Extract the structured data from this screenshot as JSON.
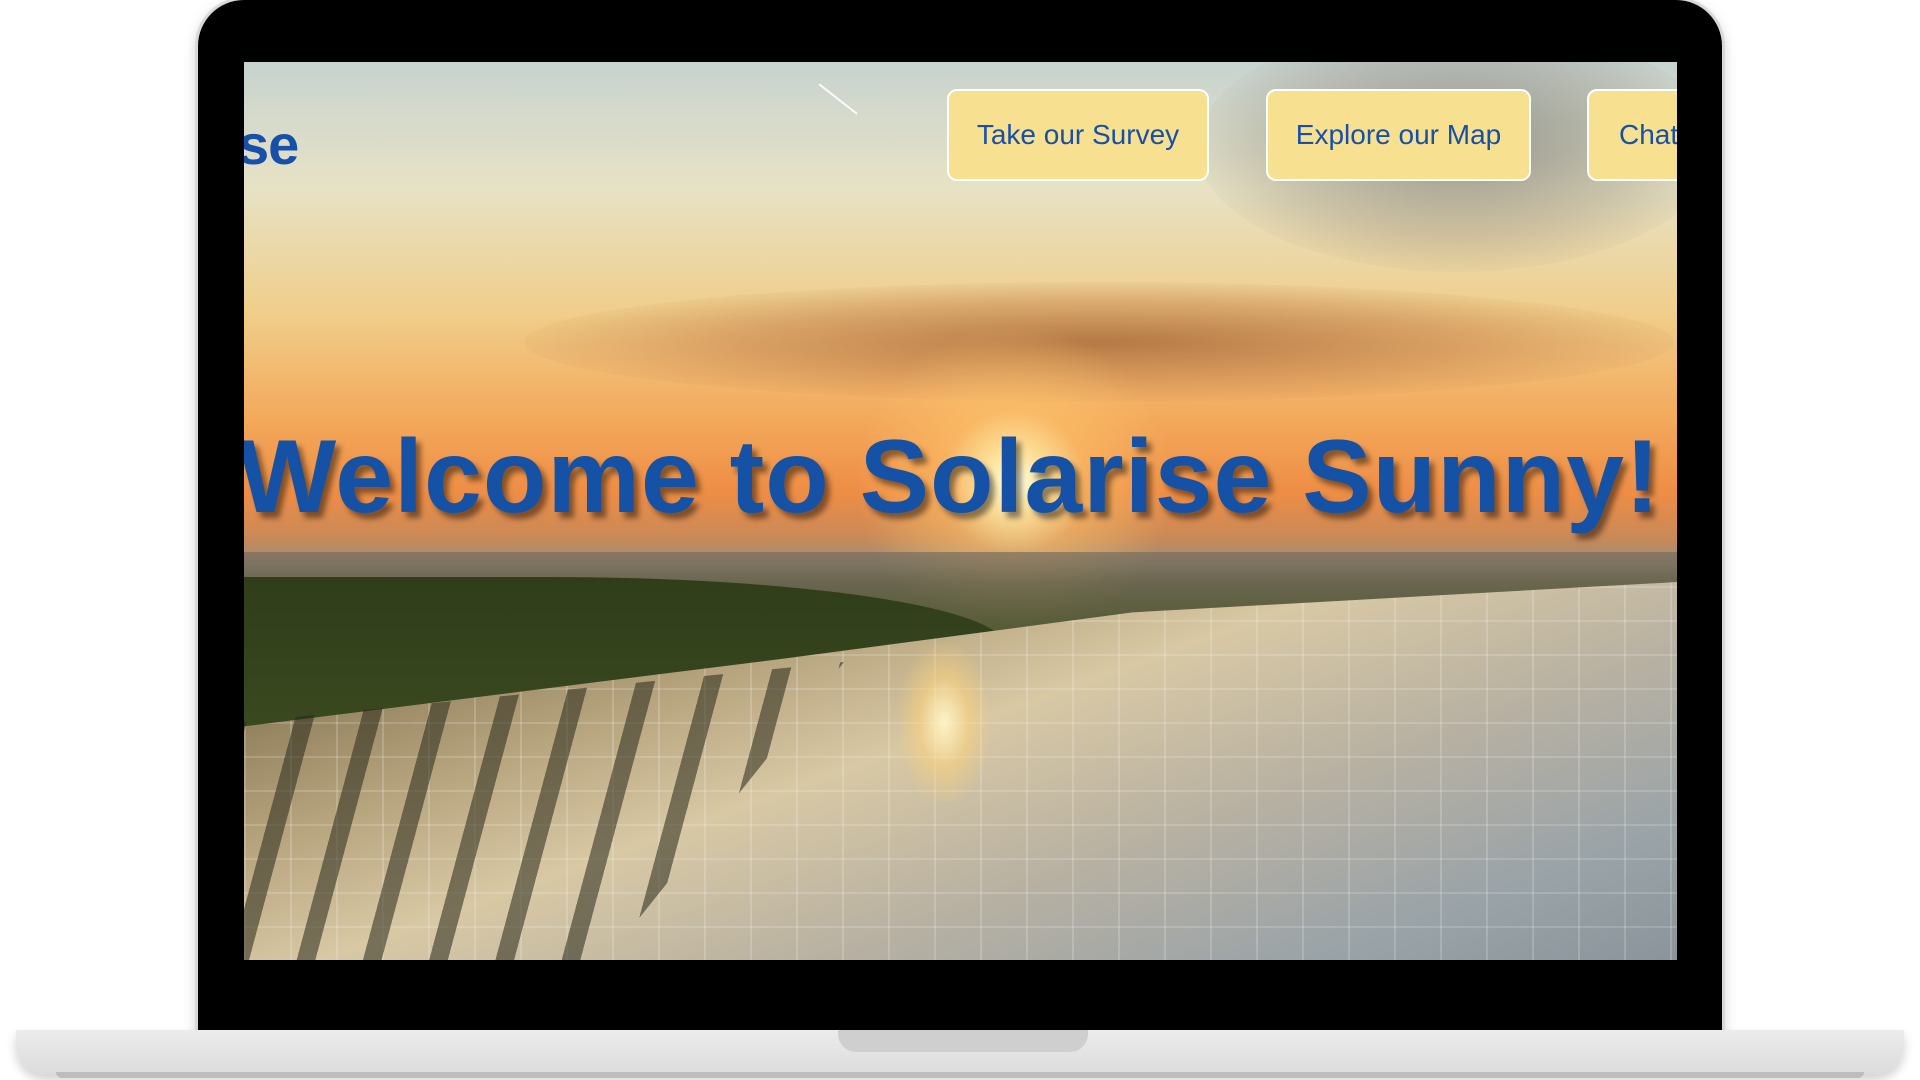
{
  "site": {
    "logo_fragment": "se",
    "hero_title": "Welcome to Solarise Sunny!"
  },
  "nav": {
    "items": [
      {
        "label": "Take our Survey"
      },
      {
        "label": "Explore our Map"
      },
      {
        "label": "Chat"
      }
    ]
  },
  "colors": {
    "brand_blue": "#1750a8",
    "button_fill": "#f7e08f",
    "button_border": "#ffffff",
    "bezel": "#000000"
  },
  "icons": {
    "device": "laptop-frame"
  }
}
